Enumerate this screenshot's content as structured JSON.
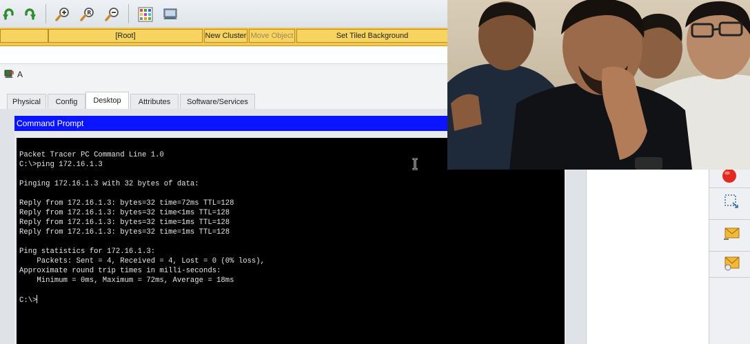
{
  "crumbbar": {
    "root_label": "[Root]",
    "new_cluster": "New Cluster",
    "move_object": "Move Object",
    "set_tiled_background": "Set Tiled Background"
  },
  "device": {
    "name": "A"
  },
  "tabs": [
    {
      "label": "Physical"
    },
    {
      "label": "Config"
    },
    {
      "label": "Desktop",
      "active": true
    },
    {
      "label": "Attributes"
    },
    {
      "label": "Software/Services"
    }
  ],
  "command_prompt": {
    "title": "Command Prompt",
    "lines": [
      "Packet Tracer PC Command Line 1.0",
      "C:\\>ping 172.16.1.3",
      "",
      "Pinging 172.16.1.3 with 32 bytes of data:",
      "",
      "Reply from 172.16.1.3: bytes=32 time=72ms TTL=128",
      "Reply from 172.16.1.3: bytes=32 time<1ms TTL=128",
      "Reply from 172.16.1.3: bytes=32 time=1ms TTL=128",
      "Reply from 172.16.1.3: bytes=32 time=1ms TTL=128",
      "",
      "Ping statistics for 172.16.1.3:",
      "    Packets: Sent = 4, Received = 4, Lost = 0 (0% loss),",
      "Approximate round trip times in milli-seconds:",
      "    Minimum = 0ms, Maximum = 72ms, Average = 18ms",
      ""
    ],
    "prompt": "C:\\>"
  },
  "icons": {
    "toolbar": [
      "undo-icon",
      "redo-icon",
      "zoom-in-icon",
      "zoom-reset-icon",
      "zoom-out-icon",
      "palette-icon",
      "custom-device-icon"
    ],
    "right_panel": [
      "delete-icon",
      "resize-icon",
      "add-simple-pdu-icon",
      "add-complex-pdu-icon"
    ]
  },
  "colors": {
    "command_title_bar": "#0a14ff",
    "terminal_bg": "#000000",
    "crumb_bar": "#f3c84a"
  }
}
